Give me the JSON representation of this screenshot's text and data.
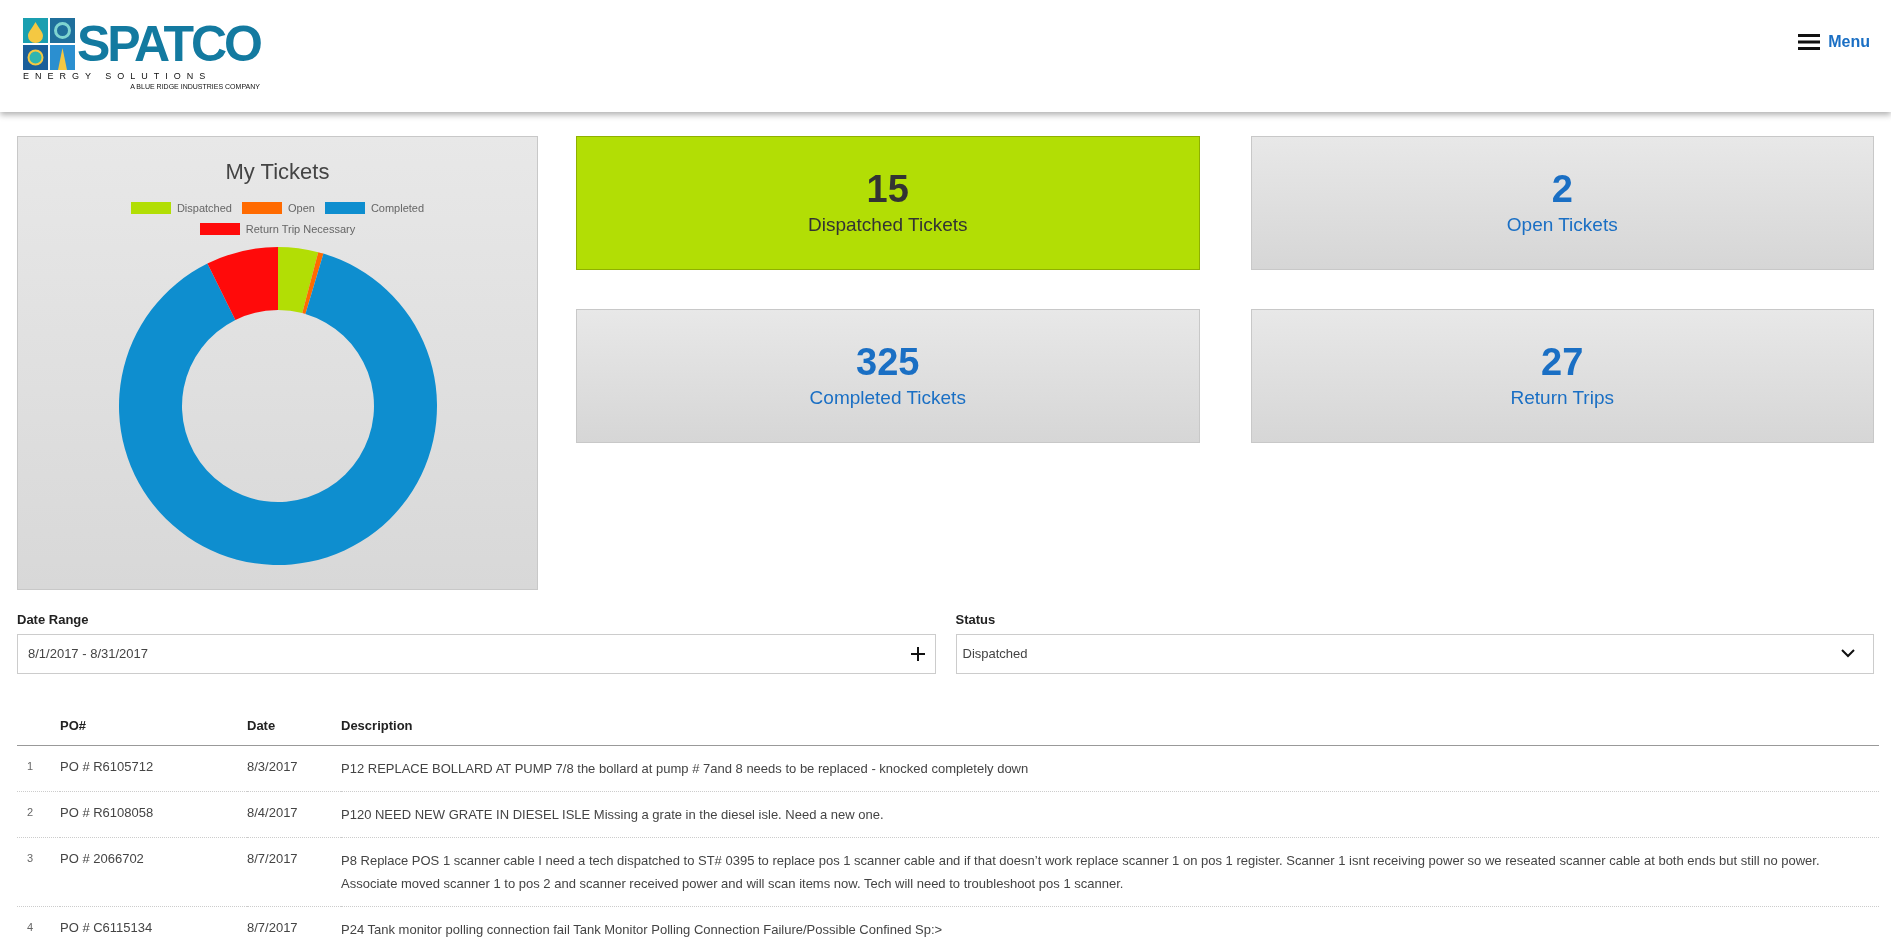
{
  "logo": {
    "name": "SPATCO",
    "tagline": "ENERGY SOLUTIONS",
    "subline": "A BLUE RIDGE INDUSTRIES COMPANY"
  },
  "menu": {
    "label": "Menu"
  },
  "chart": {
    "title": "My Tickets",
    "chart_data": {
      "type": "donut",
      "categories": [
        "Dispatched",
        "Open",
        "Completed",
        "Return Trip Necessary"
      ],
      "values": [
        4.07,
        0.54,
        88.07,
        7.32
      ],
      "colors": [
        "#b2de05",
        "#ff6a00",
        "#0e8ecf",
        "#ff0a0a"
      ]
    }
  },
  "tiles": [
    {
      "value": "15",
      "label": "Dispatched Tickets",
      "selected": true
    },
    {
      "value": "2",
      "label": "Open Tickets",
      "selected": false
    },
    {
      "value": "325",
      "label": "Completed Tickets",
      "selected": false
    },
    {
      "value": "27",
      "label": "Return Trips",
      "selected": false
    }
  ],
  "filters": {
    "date_range": {
      "label": "Date Range",
      "value": "8/1/2017 - 8/31/2017"
    },
    "status": {
      "label": "Status",
      "value": "Dispatched"
    }
  },
  "table": {
    "columns": [
      "PO#",
      "Date",
      "Description"
    ],
    "rows": [
      {
        "index": "1",
        "po": "PO # R6105712",
        "date": "8/3/2017",
        "description": "P12 REPLACE BOLLARD AT PUMP 7/8 the bollard at pump # 7and 8 needs to be replaced - knocked completely down"
      },
      {
        "index": "2",
        "po": "PO # R6108058",
        "date": "8/4/2017",
        "description": "P120 NEED NEW GRATE IN DIESEL ISLE Missing a grate in the diesel isle. Need a new one."
      },
      {
        "index": "3",
        "po": "PO # 2066702",
        "date": "8/7/2017",
        "description": "P8 Replace POS 1 scanner cable I need a tech dispatched to ST# 0395 to replace pos 1 scanner cable and if that doesn’t work replace scanner 1 on pos 1 register. Scanner 1 isnt receiving power so we reseated scanner cable at both ends but still no power. Associate moved scanner 1 to pos 2 and scanner received power and will scan items now. Tech will need to troubleshoot pos 1 scanner."
      },
      {
        "index": "4",
        "po": "PO # C6115134",
        "date": "8/7/2017",
        "description": "P24 Tank monitor polling connection fail Tank Monitor Polling Connection Failure/Possible Confined Sp:>"
      }
    ]
  }
}
